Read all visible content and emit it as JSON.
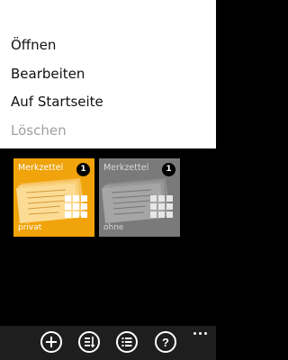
{
  "context_menu": {
    "items": [
      {
        "label": "Öffnen",
        "enabled": true
      },
      {
        "label": "Bearbeiten",
        "enabled": true
      },
      {
        "label": "Auf Startseite",
        "enabled": true
      },
      {
        "label": "Löschen",
        "enabled": false
      }
    ]
  },
  "tiles": [
    {
      "title": "Merkzettel",
      "subtitle": "privat",
      "count": "1",
      "color": "#f0a30a",
      "title_color": "#ffffff",
      "selected": true
    },
    {
      "title": "Merkzettel",
      "subtitle": "ohne",
      "count": "1",
      "color": "#7a7a7a",
      "title_color": "#d8d8d8",
      "selected": false
    }
  ],
  "app_bar": {
    "buttons": [
      {
        "icon": "add-icon"
      },
      {
        "icon": "sort-icon"
      },
      {
        "icon": "list-icon"
      },
      {
        "icon": "help-icon"
      }
    ],
    "more_icon": "more-icon"
  }
}
